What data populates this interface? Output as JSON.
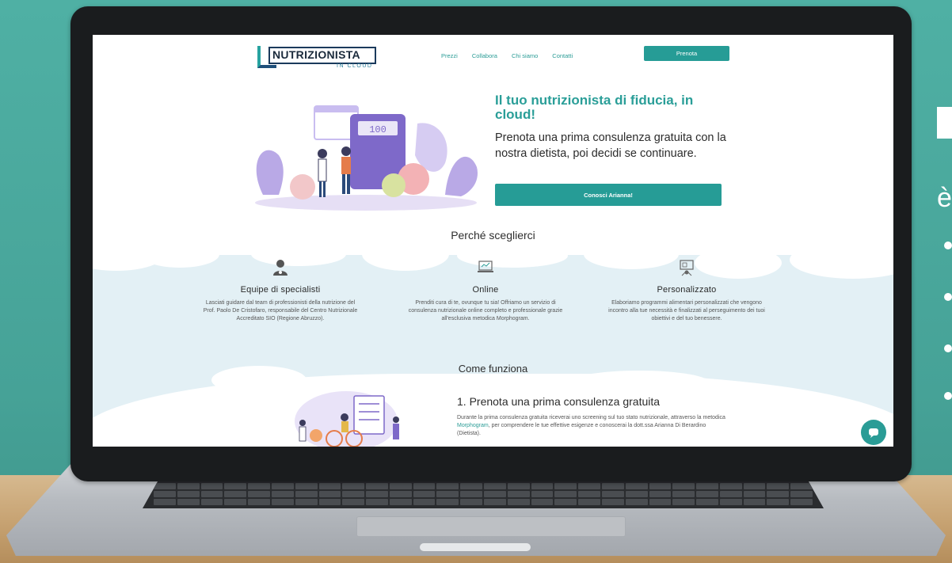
{
  "site": {
    "logo": {
      "name": "NUTRIZIONISTA",
      "sub": "IN CLOUD"
    },
    "nav": {
      "links": [
        "Prezzi",
        "Collabora",
        "Chi siamo",
        "Contatti"
      ],
      "cta": "Prenota"
    },
    "hero": {
      "title": "Il tuo nutrizionista di fiducia, in cloud!",
      "subtitle": "Prenota una prima consulenza gratuita con la nostra dietista, poi decidi se continuare.",
      "cta": "Conosci Arianna!",
      "scale_display": "100"
    },
    "why": {
      "title": "Perché sceglierci",
      "features": [
        {
          "title": "Equipe di specialisti",
          "icon": "doctor-icon",
          "text": "Lasciati guidare dal team di professionisti della nutrizione del Prof. Paolo De Cristofaro, responsabile del Centro Nutrizionale Accreditato SIO (Regione Abruzzo)."
        },
        {
          "title": "Online",
          "icon": "laptop-icon",
          "text": "Prenditi cura di te, ovunque tu sia! Offriamo un servizio di consulenza nutrizionale online completo e professionale grazie all'esclusiva metodica Morphogram."
        },
        {
          "title": "Personalizzato",
          "icon": "presentation-icon",
          "text": "Elaboriamo programmi alimentari personalizzati che vengono incontro alla tue necessità e finalizzati al perseguimento dei tuoi obiettivi e del tuo benessere."
        }
      ]
    },
    "how": {
      "title": "Come funziona",
      "step1": {
        "title": "1. Prenota una prima consulenza gratuita",
        "text_a": "Durante la prima consulenza gratuita riceverai uno screening sul tuo stato nutrizionale, attraverso la metodica ",
        "text_link": "Morphogram",
        "text_b": ", per comprendere le tue effettive esigenze e conoscerai la dott.ssa Arianna Di Berardino (Dietista)."
      }
    }
  },
  "colors": {
    "accent": "#269c96",
    "background": "#4aa79c",
    "band": "#e3f0f5"
  },
  "side": {
    "accent_char": "è"
  }
}
